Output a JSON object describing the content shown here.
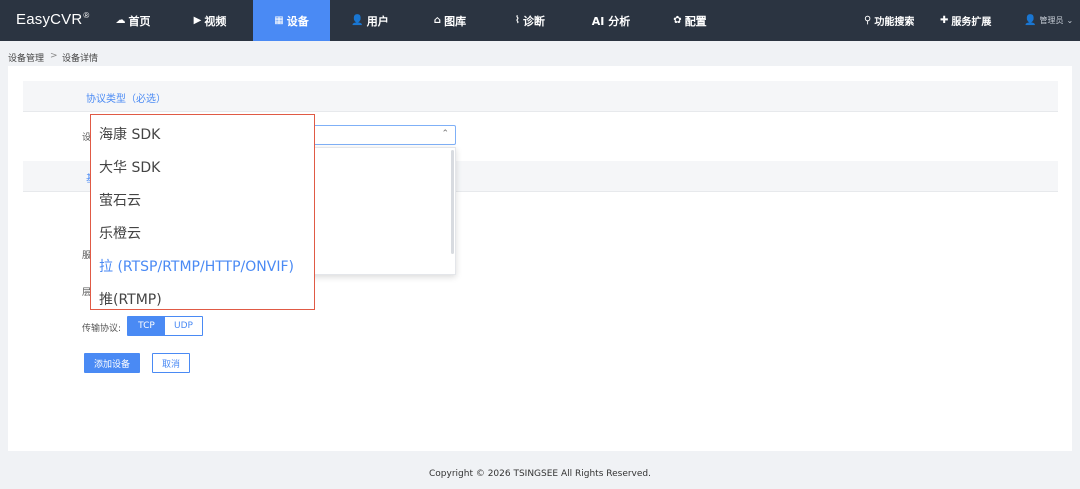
{
  "app": {
    "brand": "EasyCVR",
    "brand_mark": "®"
  },
  "nav": {
    "items": [
      {
        "icon": "☁",
        "label": "首页"
      },
      {
        "icon": "▶",
        "label": "视频"
      },
      {
        "icon": "▦",
        "label": "设备"
      },
      {
        "icon": "👤",
        "label": "用户"
      },
      {
        "icon": "⌂",
        "label": "图库"
      },
      {
        "icon": "⌇",
        "label": "诊断"
      },
      {
        "icon": "",
        "label": "AI 分析"
      },
      {
        "icon": "✿",
        "label": "配置"
      }
    ],
    "search": {
      "icon": "⚲",
      "label": "功能搜索"
    },
    "extend": {
      "icon": "✚",
      "label": "服务扩展"
    },
    "user": {
      "icon": "👤",
      "label": "管理员",
      "caret": "⌄"
    }
  },
  "breadcrumb": {
    "parent": "设备管理",
    "separator": ">",
    "current": "设备详情"
  },
  "form": {
    "section_protocol": "协议类型（必选）",
    "device_type_label_partial": "设",
    "section_two_partial": "基",
    "label_row_a_partial": "服",
    "label_row_b_partial": "层",
    "transport_label": "传输协议:",
    "transport_options": [
      "TCP",
      "UDP"
    ],
    "transport_selected": "TCP",
    "select_caret": "⌃",
    "protocol_options": [
      "海康 SDK",
      "大华 SDK",
      "萤石云",
      "乐橙云",
      "拉 (RTSP/RTMP/HTTP/ONVIF)",
      "推(RTMP)"
    ],
    "protocol_selected": "拉 (RTSP/RTMP/HTTP/ONVIF)",
    "submit_label": "添加设备",
    "cancel_label": "取消"
  },
  "footer": {
    "copyright": "Copyright © 2026 TSINGSEE All Rights Reserved."
  },
  "colors": {
    "topbar": "#2b3441",
    "accent": "#4a8af4",
    "highlight_border": "#e05a45"
  }
}
